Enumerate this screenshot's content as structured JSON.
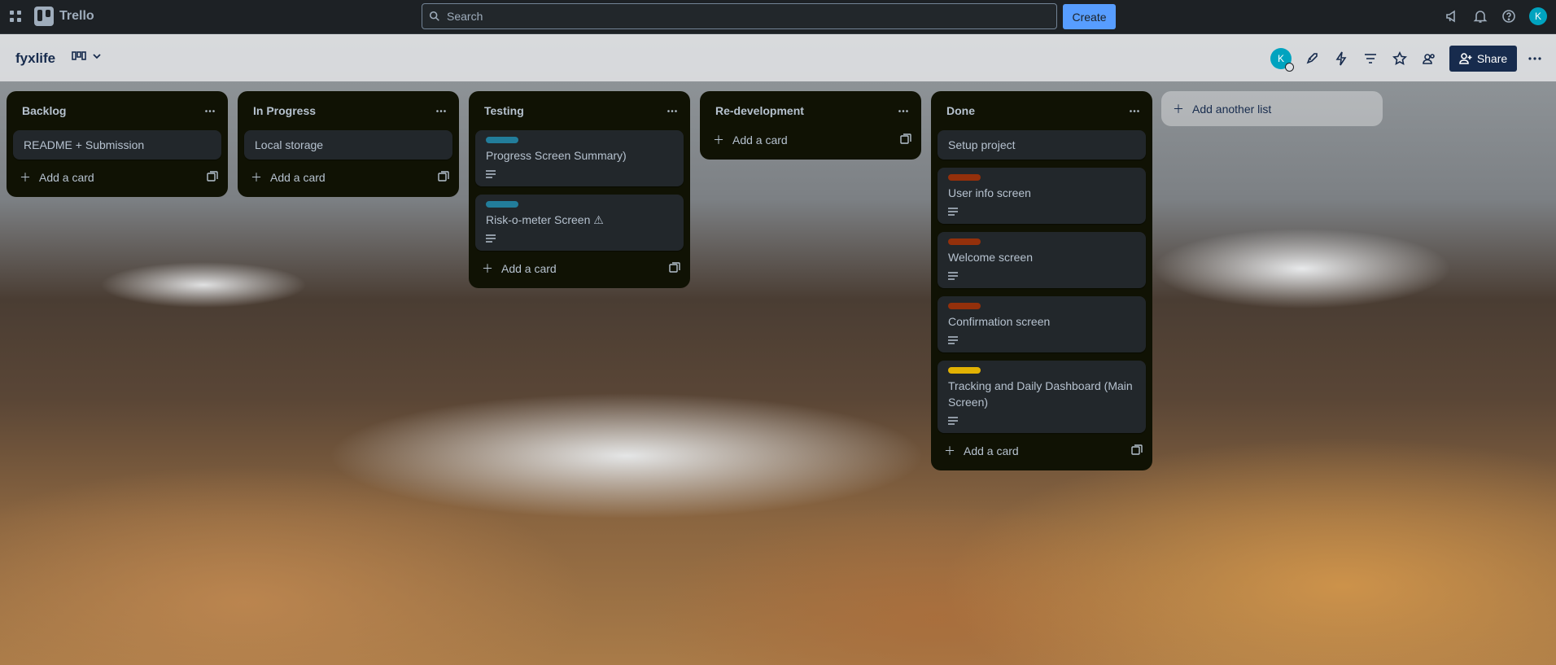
{
  "app": {
    "name": "Trello",
    "search_placeholder": "Search",
    "create_label": "Create",
    "user_initial": "K"
  },
  "board": {
    "title": "fyxlife",
    "share_label": "Share",
    "member_initial": "K"
  },
  "colors": {
    "label_teal": "#227d9b",
    "label_brown": "#94300b",
    "label_yellow": "#e2b203",
    "list_bg": "#101204",
    "card_bg": "#22272b",
    "accent": "#579dff"
  },
  "lists": [
    {
      "title": "Backlog",
      "cards": [
        {
          "text": "README + Submission"
        }
      ],
      "add_label": "Add a card"
    },
    {
      "title": "In Progress",
      "cards": [
        {
          "text": "Local storage"
        }
      ],
      "add_label": "Add a card"
    },
    {
      "title": "Testing",
      "cards": [
        {
          "text": "Progress Screen Summary)",
          "label": "teal",
          "has_description": true
        },
        {
          "text": "Risk-o-meter Screen ⚠",
          "label": "teal",
          "has_description": true
        }
      ],
      "add_label": "Add a card"
    },
    {
      "title": "Re-development",
      "cards": [],
      "add_label": "Add a card"
    },
    {
      "title": "Done",
      "cards": [
        {
          "text": "Setup project"
        },
        {
          "text": "User info screen",
          "label": "brown",
          "has_description": true
        },
        {
          "text": "Welcome screen",
          "label": "brown",
          "has_description": true
        },
        {
          "text": "Confirmation screen",
          "label": "brown",
          "has_description": true
        },
        {
          "text": "Tracking and Daily Dashboard (Main Screen)",
          "label": "yellow",
          "has_description": true
        }
      ],
      "add_label": "Add a card"
    }
  ],
  "add_list_label": "Add another list"
}
